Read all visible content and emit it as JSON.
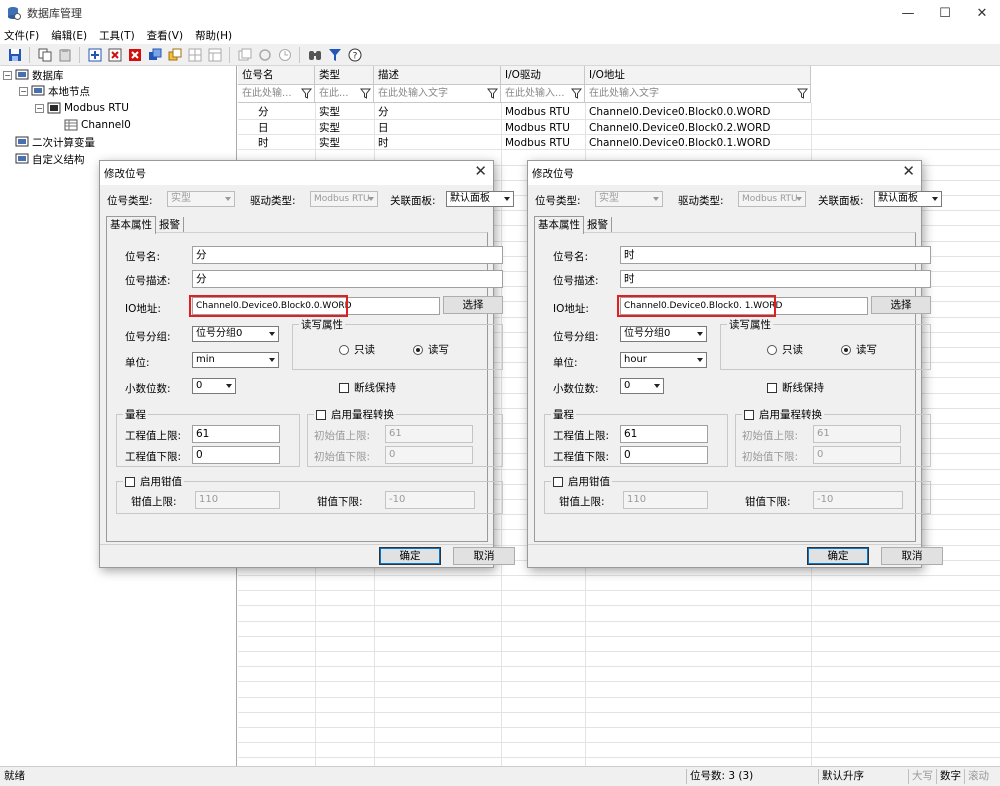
{
  "window": {
    "title": "数据库管理"
  },
  "menu": [
    "文件(F)",
    "编辑(E)",
    "工具(T)",
    "查看(V)",
    "帮助(H)"
  ],
  "tree": {
    "root": "数据库",
    "node": "本地节点",
    "driver": "Modbus RTU",
    "channel": "Channel0",
    "calc": "二次计算变量",
    "custom": "自定义结构"
  },
  "grid": {
    "headers": [
      "位号名",
      "类型",
      "描述",
      "I/O驱动",
      "I/O地址"
    ],
    "filters": [
      "在此处输...",
      "在此...",
      "在此处输入文字",
      "在此处输入...",
      "在此处输入文字"
    ],
    "rows": [
      [
        "分",
        "实型",
        "分",
        "Modbus RTU",
        "Channel0.Device0.Block0.0.WORD"
      ],
      [
        "日",
        "实型",
        "日",
        "Modbus RTU",
        "Channel0.Device0.Block0.2.WORD"
      ],
      [
        "时",
        "实型",
        "时",
        "Modbus RTU",
        "Channel0.Device0.Block0.1.WORD"
      ]
    ]
  },
  "status": {
    "ready": "就绪",
    "count": "位号数: 3  (3)",
    "sort": "默认升序",
    "caps": "大写",
    "num": "数字",
    "scroll": "滚动"
  },
  "dialogs": [
    {
      "title": "修改位号",
      "tag_type_label": "位号类型:",
      "tag_type": "实型",
      "driver_type_label": "驱动类型:",
      "driver_type": "Modbus RTU",
      "panel_label": "关联面板:",
      "panel": "默认面板",
      "tab_basic": "基本属性",
      "tab_alarm": "报警",
      "name_label": "位号名:",
      "name": "分",
      "desc_label": "位号描述:",
      "desc": "分",
      "io_label": "IO地址:",
      "io": "Channel0.Device0.Block0.0.WORD",
      "select_btn": "选择",
      "group_label": "位号分组:",
      "group": "位号分组0",
      "unit_label": "单位:",
      "unit": "min",
      "decimal_label": "小数位数:",
      "decimal": "0",
      "rw_title": "读写属性",
      "ro": "只读",
      "rw": "读写",
      "hold": "断线保持",
      "range_title": "量程",
      "eng_high_label": "工程值上限:",
      "eng_high": "61",
      "eng_low_label": "工程值下限:",
      "eng_low": "0",
      "conv_title": "启用量程转换",
      "init_high_label": "初始值上限:",
      "init_high": "61",
      "init_low_label": "初始值下限:",
      "init_low": "0",
      "clamp_title": "启用钳值",
      "clamp_high_label": "钳值上限:",
      "clamp_high": "110",
      "clamp_low_label": "钳值下限:",
      "clamp_low": "-10",
      "ok": "确定",
      "cancel": "取消"
    },
    {
      "title": "修改位号",
      "tag_type_label": "位号类型:",
      "tag_type": "实型",
      "driver_type_label": "驱动类型:",
      "driver_type": "Modbus RTU",
      "panel_label": "关联面板:",
      "panel": "默认面板",
      "tab_basic": "基本属性",
      "tab_alarm": "报警",
      "name_label": "位号名:",
      "name": "时",
      "desc_label": "位号描述:",
      "desc": "时",
      "io_label": "IO地址:",
      "io": "Channel0.Device0.Block0. 1.WORD",
      "select_btn": "选择",
      "group_label": "位号分组:",
      "group": "位号分组0",
      "unit_label": "单位:",
      "unit": "hour",
      "decimal_label": "小数位数:",
      "decimal": "0",
      "rw_title": "读写属性",
      "ro": "只读",
      "rw": "读写",
      "hold": "断线保持",
      "range_title": "量程",
      "eng_high_label": "工程值上限:",
      "eng_high": "61",
      "eng_low_label": "工程值下限:",
      "eng_low": "0",
      "conv_title": "启用量程转换",
      "init_high_label": "初始值上限:",
      "init_high": "61",
      "init_low_label": "初始值下限:",
      "init_low": "0",
      "clamp_title": "启用钳值",
      "clamp_high_label": "钳值上限:",
      "clamp_high": "110",
      "clamp_low_label": "钳值下限:",
      "clamp_low": "-10",
      "ok": "确定",
      "cancel": "取消"
    }
  ]
}
